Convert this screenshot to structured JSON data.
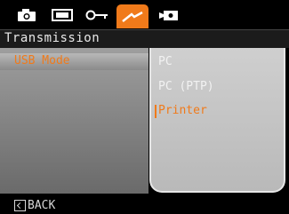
{
  "tabs": [
    {
      "icon": "camera-icon"
    },
    {
      "icon": "film-icon"
    },
    {
      "icon": "key-icon"
    },
    {
      "icon": "wrench-icon",
      "active": true
    },
    {
      "icon": "video-camera-icon"
    }
  ],
  "title": "Transmission",
  "menu": {
    "selected_item": "USB Mode"
  },
  "options": [
    "PC",
    "PC (PTP)",
    "Printer"
  ],
  "selected_option": "Printer",
  "footer": {
    "back_label": "BACK"
  },
  "colors": {
    "accent": "#f07a1a",
    "background": "#000000"
  }
}
